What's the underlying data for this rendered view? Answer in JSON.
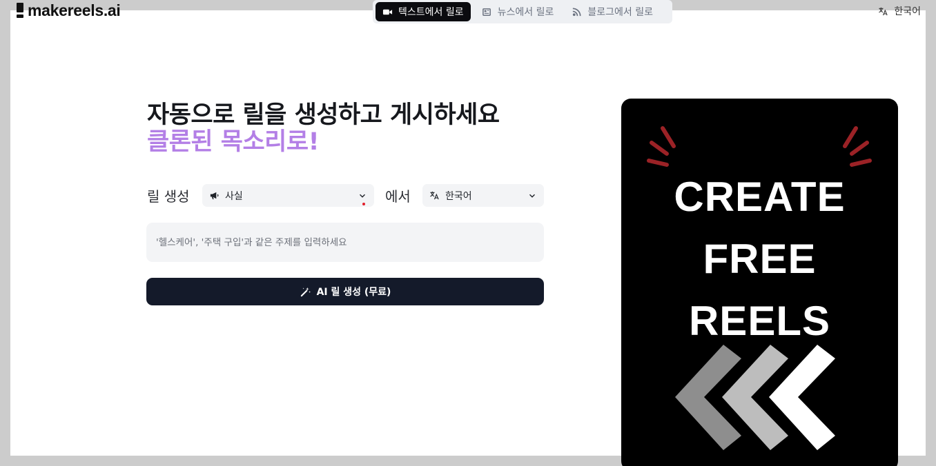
{
  "brand": {
    "name": "makereels.ai"
  },
  "tabs": [
    {
      "label": "텍스트에서 릴로",
      "icon": "video-camera-icon",
      "active": true
    },
    {
      "label": "뉴스에서 릴로",
      "icon": "newspaper-icon",
      "active": false
    },
    {
      "label": "블로그에서 릴로",
      "icon": "rss-icon",
      "active": false
    }
  ],
  "header": {
    "language": "한국어",
    "language_icon": "translate-icon"
  },
  "hero": {
    "headline": "자동으로 릴을 생성하고 게시하세요",
    "subheadline": "클론된 목소리로!",
    "accent_color": "#b37fe6"
  },
  "form": {
    "create_label": "릴 생성",
    "type_select": {
      "value": "사실",
      "icon": "megaphone-icon"
    },
    "from_label": "에서",
    "language_select": {
      "value": "한국어",
      "icon": "translate-icon"
    },
    "topic_placeholder": "'헬스케어', '주택 구입'과 같은 주제를 입력하세요",
    "generate_label": "AI 릴 생성 (무료)",
    "generate_icon": "magic-wand-icon",
    "button_color": "#141a2a"
  },
  "preview": {
    "lines": [
      "CREATE",
      "FREE",
      "REELS"
    ],
    "background": "#000000",
    "decoration": "red-sparks-and-chevron-arrows"
  }
}
